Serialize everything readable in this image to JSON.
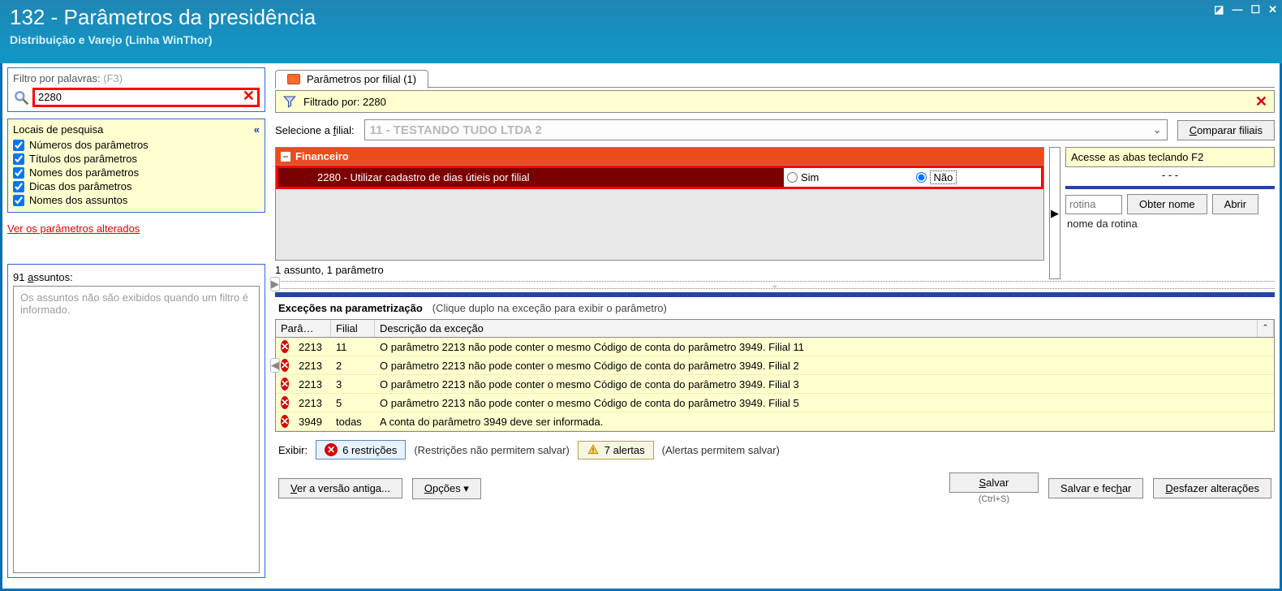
{
  "title": "132 - Parâmetros da presidência",
  "subtitle": "Distribuição e Varejo (Linha WinThor)",
  "left": {
    "filter_label": "Filtro por palavras:",
    "filter_hint": "(F3)",
    "filter_value": "2280",
    "locais_title": "Locais de pesquisa",
    "checks": [
      "Números dos parâmetros",
      "Títulos dos parâmetros",
      "Nomes dos parâmetros",
      "Dicas dos parâmetros",
      "Nomes dos assuntos"
    ],
    "alt_link": "Ver os parâmetros alterados",
    "assuntos_label": "91 assuntos:",
    "assuntos_msg": "Os assuntos não são exibidos quando um filtro é informado."
  },
  "tab_label": "Parâmetros por filial  (1)",
  "filter_bar": {
    "label": "Filtrado por: 2280"
  },
  "filial_row": {
    "label": "Selecione a filial:",
    "value": "11 - TESTANDO TUDO LTDA 2",
    "compare_btn": "Comparar filiais"
  },
  "group_name": "Financeiro",
  "param_row": {
    "text": "2280 - Utilizar cadastro de dias útieis por filial",
    "opt_yes": "Sim",
    "opt_no": "Não"
  },
  "status_line": "1 assunto, 1 parâmetro",
  "side": {
    "hint": "Acesse as abas teclando F2",
    "dashes": "-          -     -",
    "rotina_placeholder": "rotina",
    "obter": "Obter nome",
    "abrir": "Abrir",
    "nome": "nome da rotina"
  },
  "exc": {
    "title": "Exceções na parametrização",
    "sub": "(Clique duplo na exceção para exibir o parâmetro)",
    "head_p": "Parâ…",
    "head_f": "Filial",
    "head_d": "Descrição da exceção",
    "rows": [
      {
        "p": "2213",
        "f": "11",
        "d": "O parâmetro 2213 não pode conter o mesmo Código de conta do parâmetro 3949. Filial 11"
      },
      {
        "p": "2213",
        "f": "2",
        "d": "O parâmetro 2213 não pode conter o mesmo Código de conta do parâmetro 3949. Filial 2"
      },
      {
        "p": "2213",
        "f": "3",
        "d": "O parâmetro 2213 não pode conter o mesmo Código de conta do parâmetro 3949. Filial 3"
      },
      {
        "p": "2213",
        "f": "5",
        "d": "O parâmetro 2213 não pode conter o mesmo Código de conta do parâmetro 3949. Filial 5"
      },
      {
        "p": "3949",
        "f": "todas",
        "d": "A conta do parâmetro 3949 deve ser informada."
      }
    ]
  },
  "exhibit": {
    "label": "Exibir:",
    "restr": "6 restrições",
    "restr_note": "(Restrições não permitem salvar)",
    "alerts": "7 alertas",
    "alerts_note": "(Alertas permitem salvar)"
  },
  "buttons": {
    "old": "Ver a versão antiga...",
    "opts": "Opções",
    "save": "Salvar",
    "save_close": "Salvar e fechar",
    "undo": "Desfazer alterações",
    "save_hint": "(Ctrl+S)"
  }
}
